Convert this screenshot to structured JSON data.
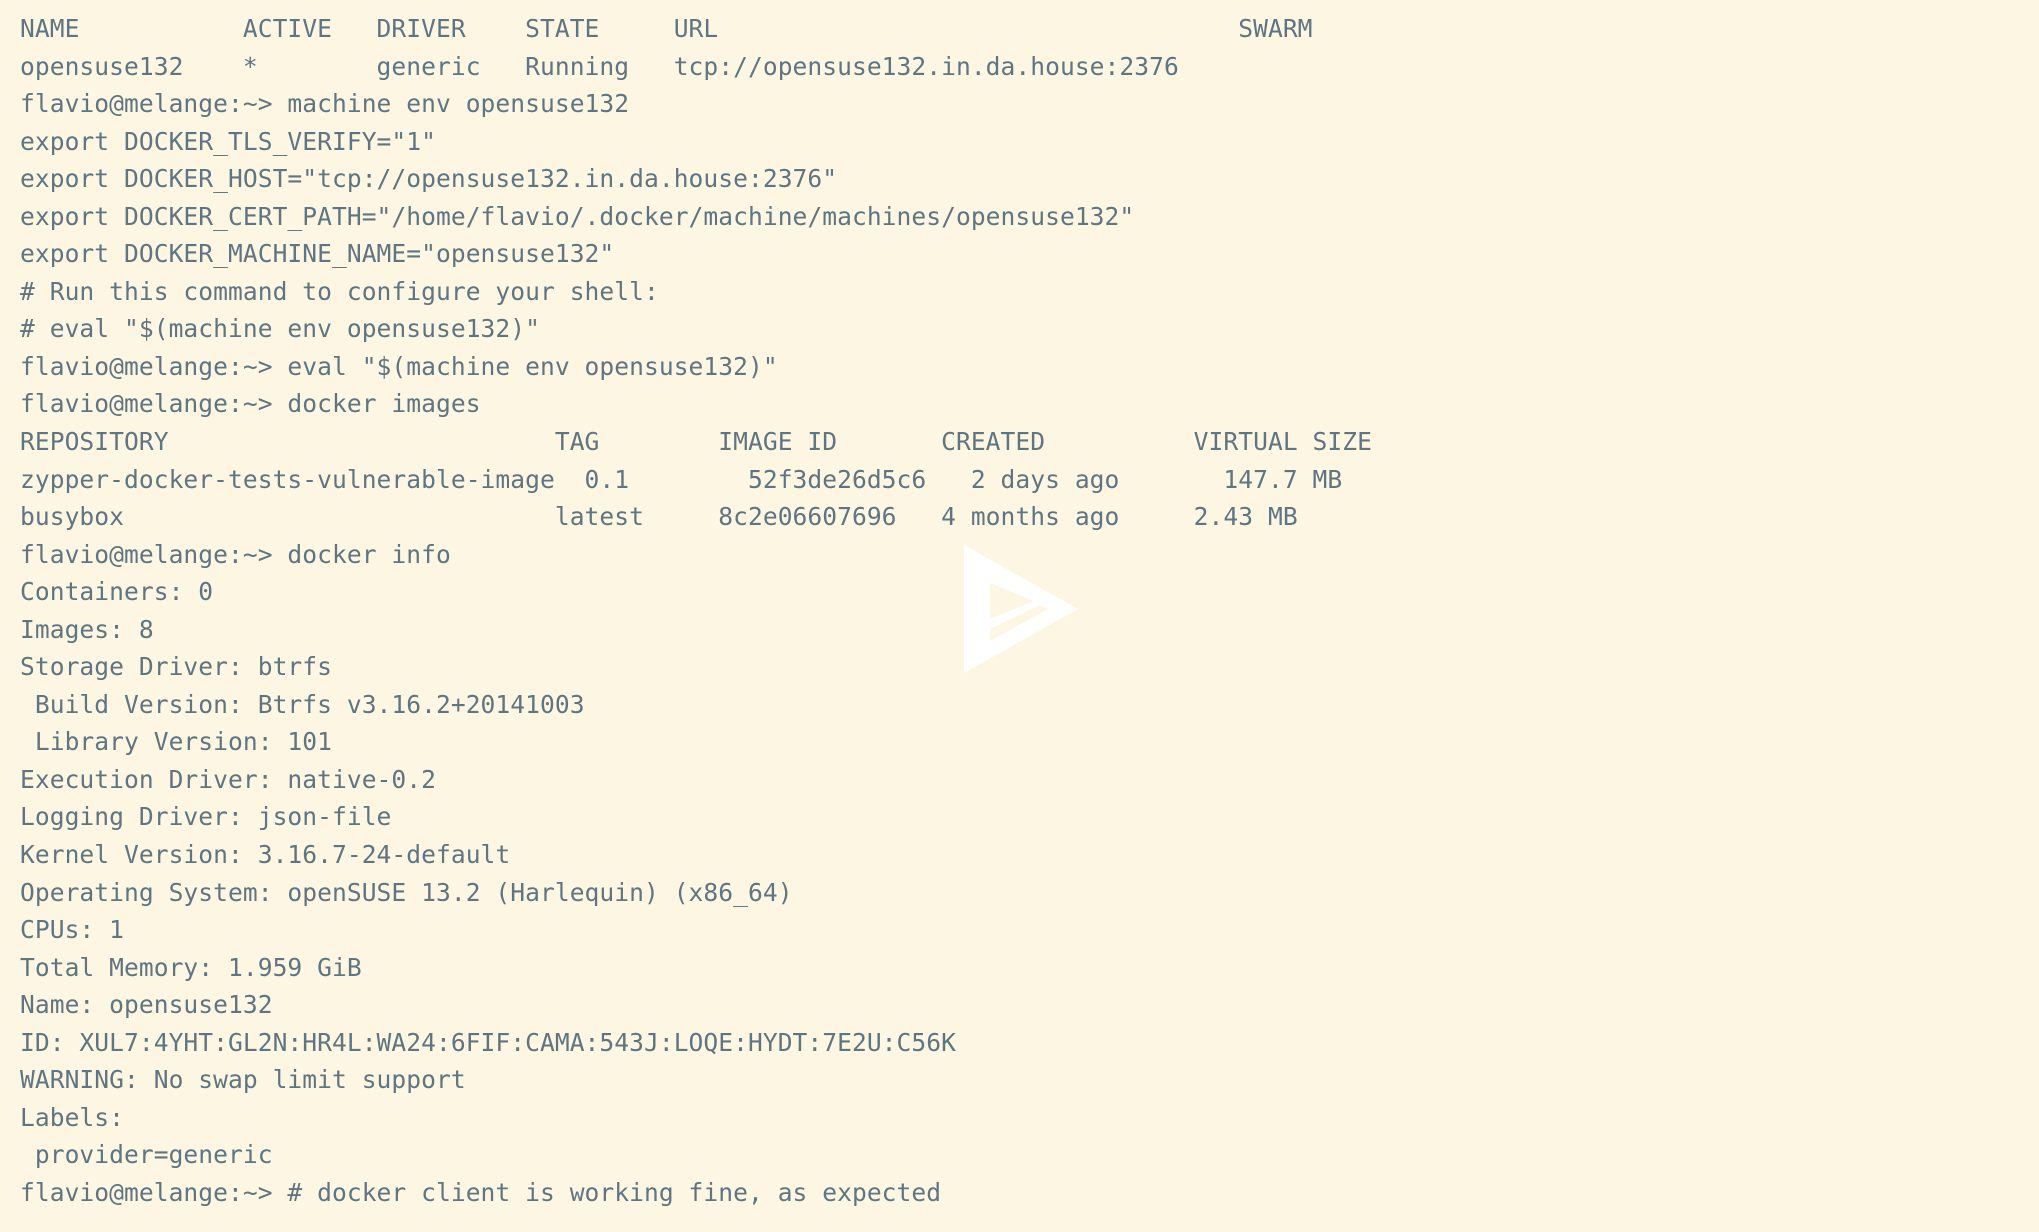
{
  "terminal": {
    "background_color": "#fdf6e3",
    "text_color": "#5f7582",
    "watermark": {
      "name": "play-triangle-logo",
      "color": "#ffffff"
    },
    "lines": [
      "NAME           ACTIVE   DRIVER    STATE     URL                                   SWARM",
      "opensuse132    *        generic   Running   tcp://opensuse132.in.da.house:2376",
      "flavio@melange:~> machine env opensuse132",
      "export DOCKER_TLS_VERIFY=\"1\"",
      "export DOCKER_HOST=\"tcp://opensuse132.in.da.house:2376\"",
      "export DOCKER_CERT_PATH=\"/home/flavio/.docker/machine/machines/opensuse132\"",
      "export DOCKER_MACHINE_NAME=\"opensuse132\"",
      "# Run this command to configure your shell:",
      "# eval \"$(machine env opensuse132)\"",
      "flavio@melange:~> eval \"$(machine env opensuse132)\"",
      "flavio@melange:~> docker images",
      "REPOSITORY                          TAG        IMAGE ID       CREATED          VIRTUAL SIZE",
      "zypper-docker-tests-vulnerable-image  0.1        52f3de26d5c6   2 days ago       147.7 MB",
      "busybox                             latest     8c2e06607696   4 months ago     2.43 MB",
      "flavio@melange:~> docker info",
      "Containers: 0",
      "Images: 8",
      "Storage Driver: btrfs",
      " Build Version: Btrfs v3.16.2+20141003",
      " Library Version: 101",
      "Execution Driver: native-0.2",
      "Logging Driver: json-file",
      "Kernel Version: 3.16.7-24-default",
      "Operating System: openSUSE 13.2 (Harlequin) (x86_64)",
      "CPUs: 1",
      "Total Memory: 1.959 GiB",
      "Name: opensuse132",
      "ID: XUL7:4YHT:GL2N:HR4L:WA24:6FIF:CAMA:543J:LOQE:HYDT:7E2U:C56K",
      "WARNING: No swap limit support",
      "Labels:",
      " provider=generic",
      "flavio@melange:~> # docker client is working fine, as expected"
    ],
    "machine_ls": {
      "headers": [
        "NAME",
        "ACTIVE",
        "DRIVER",
        "STATE",
        "URL",
        "SWARM"
      ],
      "rows": [
        {
          "name": "opensuse132",
          "active": "*",
          "driver": "generic",
          "state": "Running",
          "url": "tcp://opensuse132.in.da.house:2376",
          "swarm": ""
        }
      ]
    },
    "docker_images": {
      "headers": [
        "REPOSITORY",
        "TAG",
        "IMAGE ID",
        "CREATED",
        "VIRTUAL SIZE"
      ],
      "rows": [
        {
          "repository": "zypper-docker-tests-vulnerable-image",
          "tag": "0.1",
          "image_id": "52f3de26d5c6",
          "created": "2 days ago",
          "virtual_size": "147.7 MB"
        },
        {
          "repository": "busybox",
          "tag": "latest",
          "image_id": "8c2e06607696",
          "created": "4 months ago",
          "virtual_size": "2.43 MB"
        }
      ]
    },
    "docker_info": {
      "containers": "0",
      "images": "8",
      "storage_driver": "btrfs",
      "build_version": "Btrfs v3.16.2+20141003",
      "library_version": "101",
      "execution_driver": "native-0.2",
      "logging_driver": "json-file",
      "kernel_version": "3.16.7-24-default",
      "operating_system": "openSUSE 13.2 (Harlequin) (x86_64)",
      "cpus": "1",
      "total_memory": "1.959 GiB",
      "name": "opensuse132",
      "id": "XUL7:4YHT:GL2N:HR4L:WA24:6FIF:CAMA:543J:LOQE:HYDT:7E2U:C56K",
      "warning": "WARNING: No swap limit support",
      "labels": [
        "provider=generic"
      ]
    },
    "prompt": "flavio@melange:~>",
    "env_exports": [
      "DOCKER_TLS_VERIFY=\"1\"",
      "DOCKER_HOST=\"tcp://opensuse132.in.da.house:2376\"",
      "DOCKER_CERT_PATH=\"/home/flavio/.docker/machine/machines/opensuse132\"",
      "DOCKER_MACHINE_NAME=\"opensuse132\""
    ]
  }
}
